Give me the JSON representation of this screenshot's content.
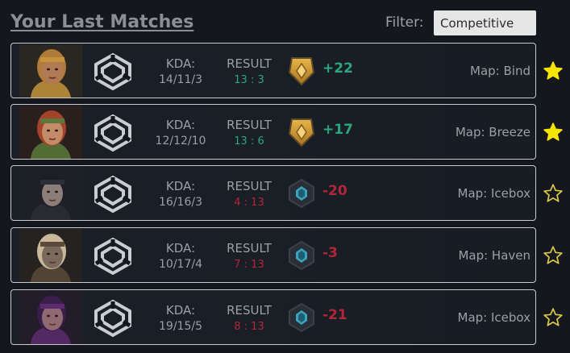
{
  "header": {
    "title": "Your Last Matches",
    "filter_label": "Filter:",
    "filter_value": "Competitive"
  },
  "colors": {
    "win": "#2aa77c",
    "loss": "#b3263a",
    "star": "#f5e500"
  },
  "matches": [
    {
      "agent_icon": "agent-portrait-icon",
      "kda_label": "KDA:",
      "kda": "14/11/3",
      "result_label": "RESULT",
      "result": "13 : 3",
      "outcome": "win",
      "rank_icon": "gold-rank-icon",
      "rr": "+22",
      "map": "Map: Bind",
      "starred": true
    },
    {
      "agent_icon": "agent-portrait-icon",
      "kda_label": "KDA:",
      "kda": "12/12/10",
      "result_label": "RESULT",
      "result": "13 : 6",
      "outcome": "win",
      "rank_icon": "gold-rank-icon",
      "rr": "+17",
      "map": "Map: Breeze",
      "starred": true
    },
    {
      "agent_icon": "agent-portrait-icon",
      "kda_label": "KDA:",
      "kda": "16/16/3",
      "result_label": "RESULT",
      "result": "4 : 13",
      "outcome": "loss",
      "rank_icon": "diamond-rank-icon",
      "rr": "-20",
      "map": "Map: Icebox",
      "starred": false
    },
    {
      "agent_icon": "agent-portrait-icon",
      "kda_label": "KDA:",
      "kda": "10/17/4",
      "result_label": "RESULT",
      "result": "7 : 13",
      "outcome": "loss",
      "rank_icon": "diamond-rank-icon",
      "rr": "-3",
      "map": "Map: Haven",
      "starred": false
    },
    {
      "agent_icon": "agent-portrait-icon",
      "kda_label": "KDA:",
      "kda": "19/15/5",
      "result_label": "RESULT",
      "result": "8 : 13",
      "outcome": "loss",
      "rank_icon": "diamond-rank-icon",
      "rr": "-21",
      "map": "Map: Icebox",
      "starred": false
    }
  ]
}
